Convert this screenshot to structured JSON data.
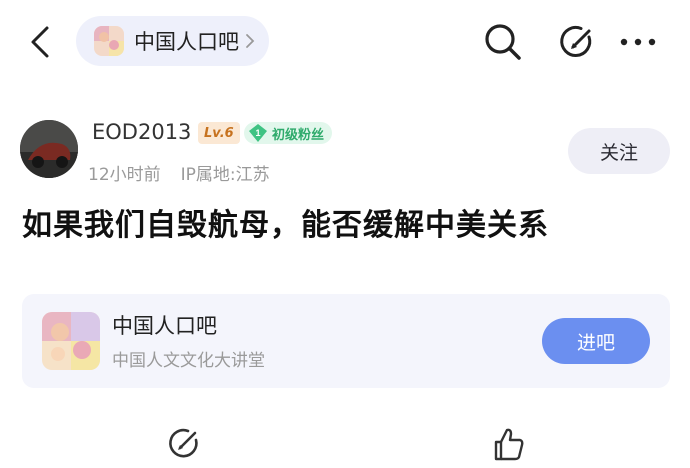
{
  "topbar": {
    "back_icon": "back-arrow-icon",
    "forum_chip_label": "中国人口吧",
    "chevron_icon": "chevron-right-icon",
    "search_icon": "search-icon",
    "edit_icon": "edit-icon",
    "more_icon": "more-icon"
  },
  "author": {
    "name": "EOD2013",
    "level": "Lv.6",
    "fan_level": "1",
    "fan_title": "初级粉丝",
    "time": "12小时前",
    "ip_location": "IP属地:江苏",
    "follow_label": "关注"
  },
  "post": {
    "title": "如果我们自毁航母，能否缓解中美关系"
  },
  "forum_card": {
    "name": "中国人口吧",
    "description": "中国人文文化大讲堂",
    "enter_label": "进吧"
  },
  "bottom_bar": {
    "comment_icon": "comment-edit-icon",
    "like_icon": "thumbs-up-icon"
  },
  "colors": {
    "accent": "#6b8ff0",
    "chip_bg": "#eef0fb",
    "card_bg": "#f4f5fc",
    "level_badge": "#c7721e",
    "fan_badge": "#2eaa6b"
  }
}
